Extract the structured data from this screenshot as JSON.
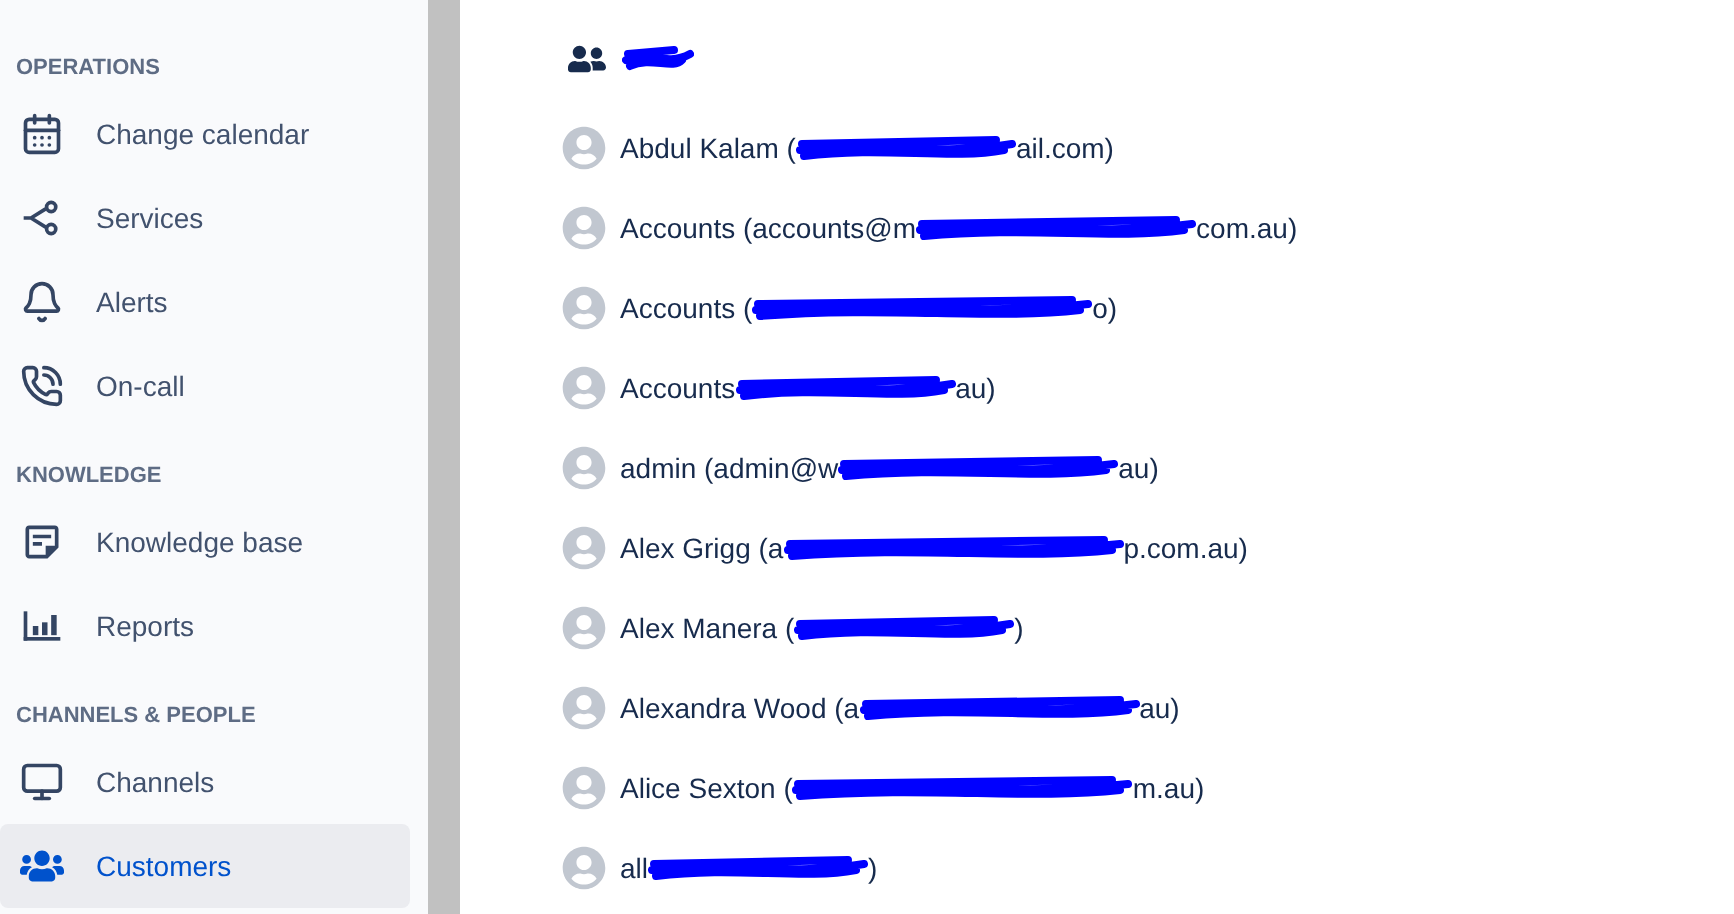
{
  "sidebar": {
    "sections": [
      {
        "title": "OPERATIONS",
        "items": [
          {
            "kind": "calendar",
            "label": "Change calendar",
            "selected": false
          },
          {
            "kind": "services",
            "label": "Services",
            "selected": false
          },
          {
            "kind": "alerts",
            "label": "Alerts",
            "selected": false
          },
          {
            "kind": "oncall",
            "label": "On-call",
            "selected": false
          }
        ]
      },
      {
        "title": "KNOWLEDGE",
        "items": [
          {
            "kind": "knowledge",
            "label": "Knowledge base",
            "selected": false
          },
          {
            "kind": "reports",
            "label": "Reports",
            "selected": false
          }
        ]
      },
      {
        "title": "CHANNELS & PEOPLE",
        "items": [
          {
            "kind": "channels",
            "label": "Channels",
            "selected": false
          },
          {
            "kind": "customers",
            "label": "Customers",
            "selected": true
          }
        ]
      }
    ]
  },
  "organization": {
    "members": [
      {
        "before": "Abdul Kalam (",
        "after": "ail.com)"
      },
      {
        "before": "Accounts (accounts@m",
        "after": "com.au)"
      },
      {
        "before": "Accounts (",
        "after": "o)"
      },
      {
        "before": "Accounts",
        "after": "au)"
      },
      {
        "before": "admin (admin@w",
        "after": "au)"
      },
      {
        "before": "Alex Grigg (a",
        "after": "p.com.au)"
      },
      {
        "before": "Alex Manera (",
        "after": ")"
      },
      {
        "before": "Alexandra Wood (a",
        "after": "au)"
      },
      {
        "before": "Alice Sexton (",
        "after": "m.au)"
      },
      {
        "before": "all",
        "after": ")"
      }
    ]
  }
}
